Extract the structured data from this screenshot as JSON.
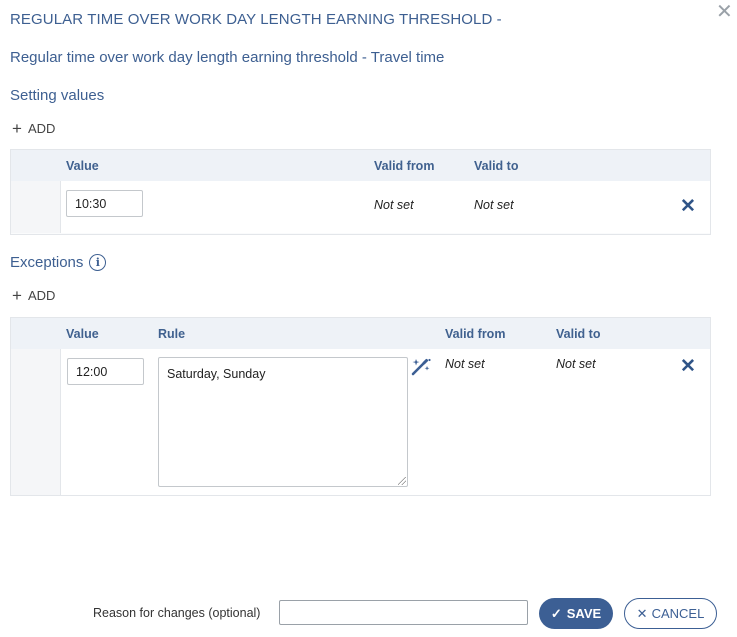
{
  "dialog": {
    "title": "REGULAR TIME OVER WORK DAY LENGTH EARNING THRESHOLD -",
    "close_icon": "close-icon",
    "subtitle": "Regular time over work day length earning threshold - Travel time"
  },
  "setting_values": {
    "heading": "Setting values",
    "add_label": "ADD",
    "columns": {
      "value": "Value",
      "valid_from": "Valid from",
      "valid_to": "Valid to"
    },
    "rows": [
      {
        "value": "10:30",
        "valid_from": "Not set",
        "valid_to": "Not set"
      }
    ]
  },
  "exceptions": {
    "heading": "Exceptions",
    "info_icon": "info-icon",
    "add_label": "ADD",
    "columns": {
      "value": "Value",
      "rule": "Rule",
      "valid_from": "Valid from",
      "valid_to": "Valid to"
    },
    "rows": [
      {
        "value": "12:00",
        "rule": "Saturday, Sunday",
        "valid_from": "Not set",
        "valid_to": "Not set"
      }
    ]
  },
  "footer": {
    "reason_label": "Reason for changes (optional)",
    "reason_value": "",
    "save_label": "SAVE",
    "cancel_label": "CANCEL"
  },
  "colors": {
    "accent": "#3c5f94",
    "header_bg": "#eef2f7",
    "heading_text": "#3d5f91"
  }
}
